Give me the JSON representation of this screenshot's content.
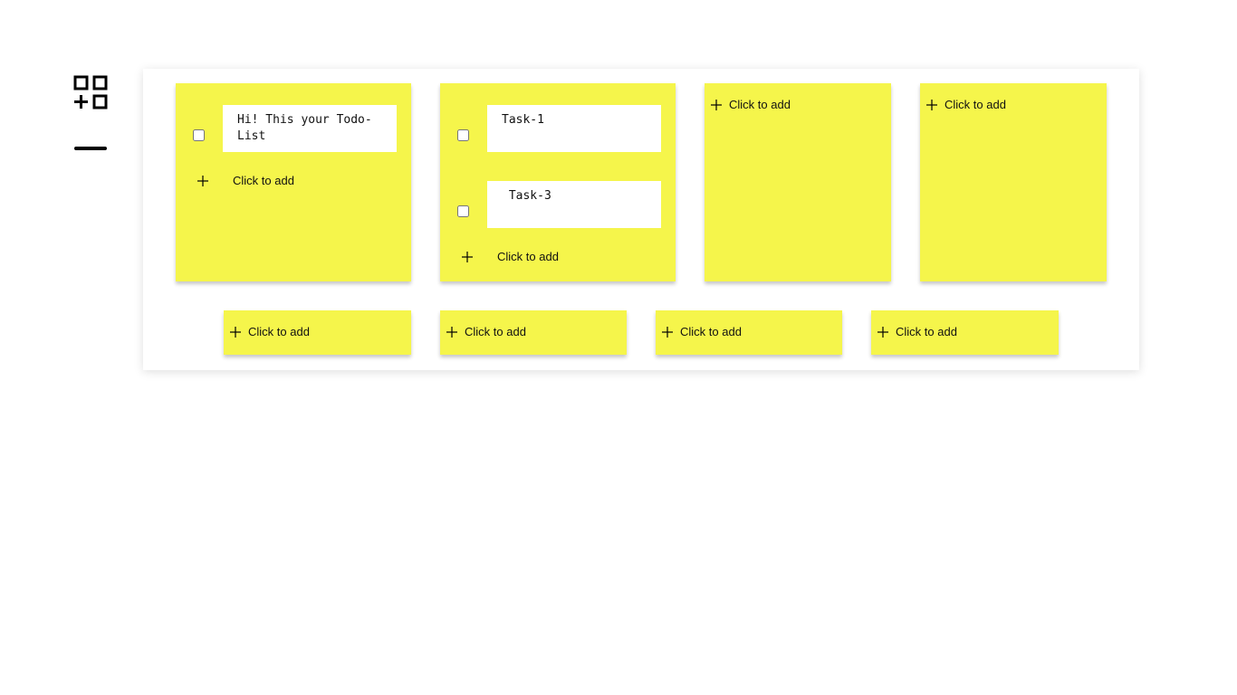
{
  "sidebar": {
    "add_board_icon": "add-board-icon",
    "collapse_icon": "minus-icon"
  },
  "colors": {
    "note_background": "#f5f54b",
    "board_background": "#ffffff",
    "text": "#111111"
  },
  "notes": [
    {
      "tasks": [
        {
          "text": "Hi! This your Todo-List",
          "checked": false
        }
      ],
      "add_label": "Click to add"
    },
    {
      "tasks": [
        {
          "text": "Task-1",
          "checked": false
        },
        {
          "text": " Task-3",
          "checked": false
        }
      ],
      "add_label": "Click to add"
    },
    {
      "tasks": [],
      "add_label": "Click to add"
    },
    {
      "tasks": [],
      "add_label": "Click to add"
    },
    {
      "tasks": [],
      "add_label": "Click to add"
    },
    {
      "tasks": [],
      "add_label": "Click to add"
    },
    {
      "tasks": [],
      "add_label": "Click to add"
    },
    {
      "tasks": [],
      "add_label": "Click to add"
    }
  ]
}
